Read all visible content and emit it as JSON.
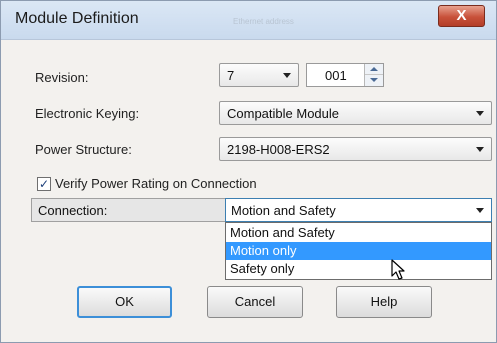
{
  "window": {
    "title": "Module Definition",
    "faded_title_text": "Ethernet address",
    "close_symbol": "X"
  },
  "revision": {
    "label": "Revision:",
    "major_value": "7",
    "minor_value": "001"
  },
  "keying": {
    "label": "Electronic Keying:",
    "value": "Compatible Module"
  },
  "power_structure": {
    "label": "Power Structure:",
    "value": "2198-H008-ERS2"
  },
  "verify_power": {
    "label": "Verify Power Rating on Connection",
    "checked": true,
    "check_mark": "✓"
  },
  "connection": {
    "label": "Connection:",
    "value": "Motion and Safety",
    "options": [
      "Motion and Safety",
      "Motion only",
      "Safety only"
    ],
    "highlighted_option": "Motion only"
  },
  "buttons": {
    "ok": "OK",
    "cancel": "Cancel",
    "help": "Help"
  },
  "colors": {
    "selection": "#3399ff",
    "close_button": "#c8513a",
    "default_button_border": "#3c8fd8"
  },
  "icons": {
    "cursor": "mouse-pointer-icon"
  }
}
